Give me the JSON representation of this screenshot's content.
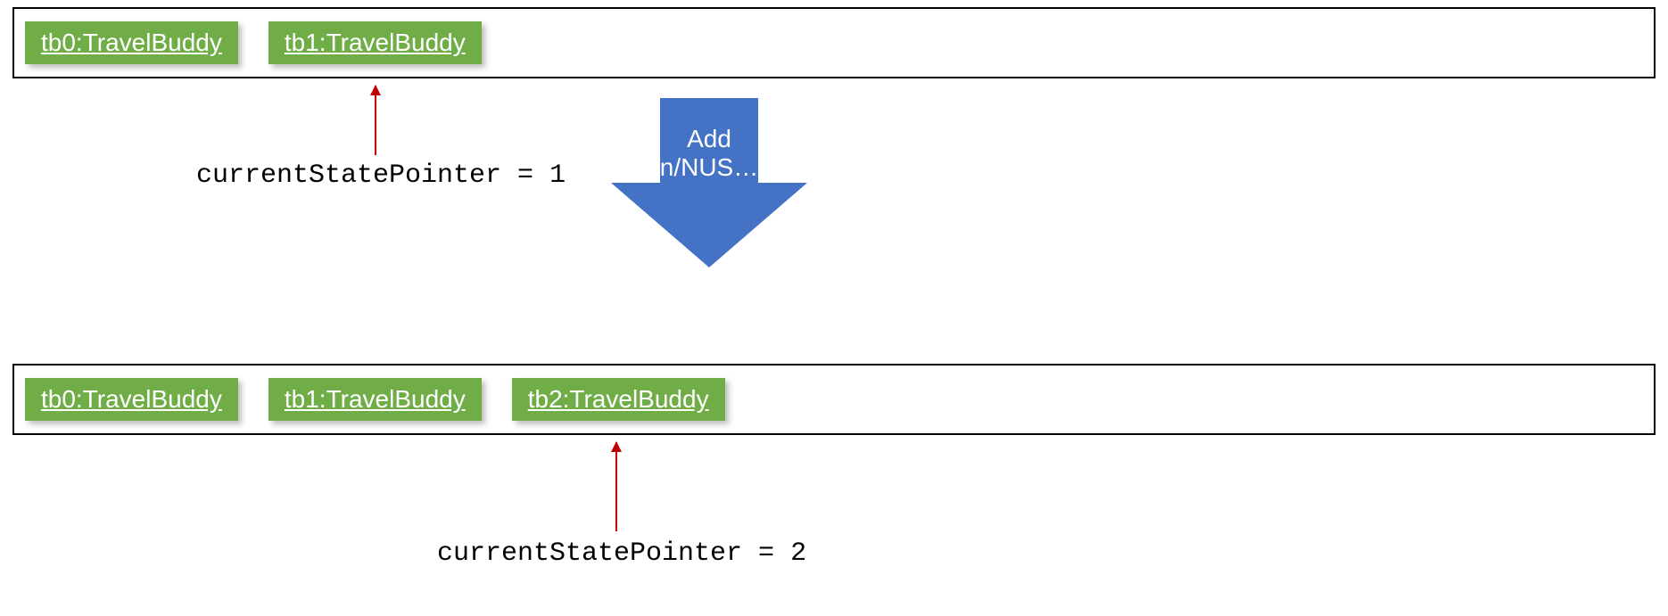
{
  "states": {
    "top": {
      "boxes": [
        "tb0:TravelBuddy",
        "tb1:TravelBuddy"
      ]
    },
    "bottom": {
      "boxes": [
        "tb0:TravelBuddy",
        "tb1:TravelBuddy",
        "tb2:TravelBuddy"
      ]
    }
  },
  "pointers": {
    "top": {
      "label": "currentStatePointer = 1"
    },
    "bottom": {
      "label": "currentStatePointer = 2"
    }
  },
  "transition": {
    "line1": "Add",
    "line2": "n/NUS…"
  },
  "colors": {
    "box_fill": "#70ad47",
    "arrow_fill": "#4472c4",
    "pointer_color": "#c00000"
  }
}
